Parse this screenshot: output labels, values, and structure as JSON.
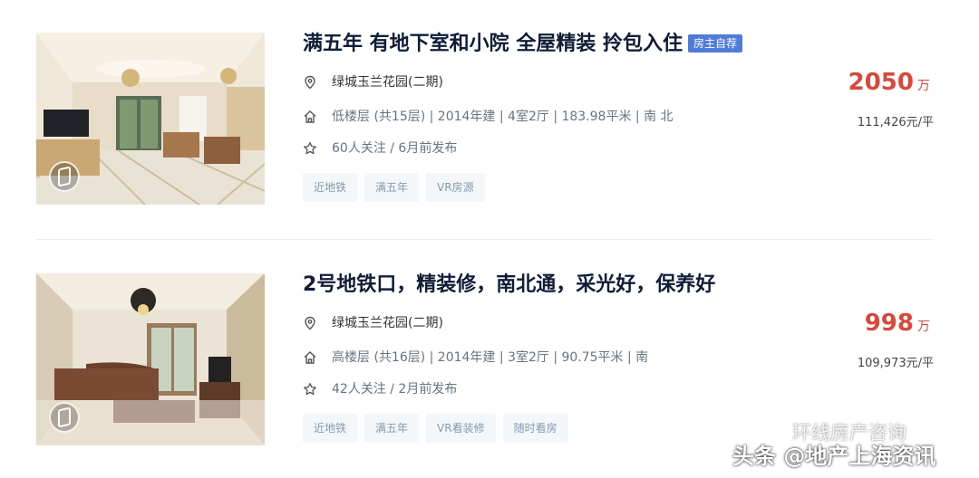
{
  "listings": [
    {
      "title": "满五年 有地下室和小院 全屋精装 拎包入住",
      "badge": "房主自荐",
      "location": "绿城玉兰花园(二期)",
      "house_info": "低楼层 (共15层) | 2014年建 | 4室2厅 | 183.98平米 | 南 北",
      "follow_info": "60人关注 / 6月前发布",
      "tags": [
        "近地铁",
        "满五年",
        "VR房源"
      ],
      "total_price": "2050",
      "price_unit": "万",
      "unit_price": "111,426元/平"
    },
    {
      "title": "2号地铁口，精装修，南北通，采光好，保养好",
      "location": "绿城玉兰花园(二期)",
      "house_info": "高楼层 (共16层) | 2014年建 | 3室2厅 | 90.75平米 | 南",
      "follow_info": "42人关注 / 2月前发布",
      "tags": [
        "近地铁",
        "满五年",
        "VR看装修",
        "随时看房"
      ],
      "total_price": "998",
      "price_unit": "万",
      "unit_price": "109,973元/平"
    }
  ],
  "watermark": {
    "line1": "环线房产咨询",
    "line2": "头条 @地产上海资讯"
  },
  "colors": {
    "price": "#d7493b",
    "badge": "#4f7bd9",
    "title": "#101d37",
    "tag_bg": "#f4f7f9",
    "tag_text": "#849aae"
  },
  "icons": {
    "location": "map-pin-icon",
    "house": "house-icon",
    "follow": "star-icon",
    "vr": "vr-view-icon",
    "watermark": "wechat-icon"
  }
}
